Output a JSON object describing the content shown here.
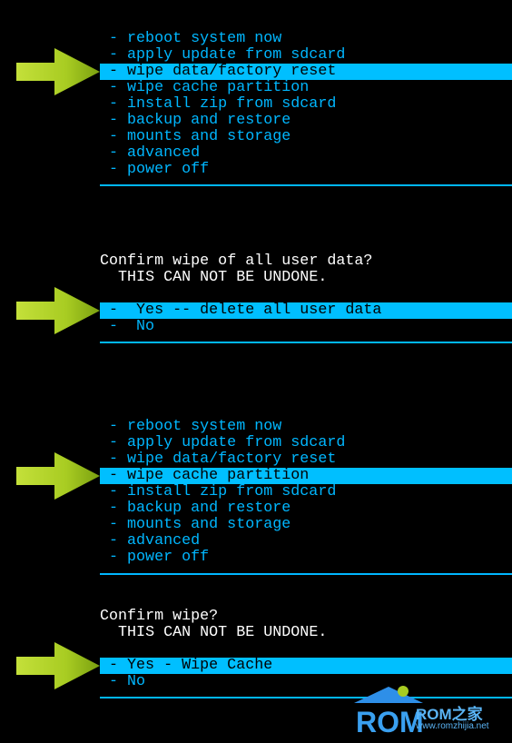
{
  "colors": {
    "menu_text": "#00b7ff",
    "highlight": "#00bfff",
    "arrow": "#a8cc22",
    "background": "#000000"
  },
  "menu1": {
    "items": [
      "- reboot system now",
      "- apply update from sdcard",
      "- wipe data/factory reset",
      "- wipe cache partition",
      "- install zip from sdcard",
      "- backup and restore",
      "- mounts and storage",
      "- advanced",
      "- power off"
    ],
    "selected": 2
  },
  "confirm1": {
    "title": "Confirm wipe of all user data?",
    "warning": "  THIS CAN NOT BE UNDONE.",
    "options": [
      "-  Yes -- delete all user data",
      "-  No"
    ],
    "selected": 0
  },
  "menu2": {
    "items": [
      "- reboot system now",
      "- apply update from sdcard",
      "- wipe data/factory reset",
      "- wipe cache partition",
      "- install zip from sdcard",
      "- backup and restore",
      "- mounts and storage",
      "- advanced",
      "- power off"
    ],
    "selected": 3
  },
  "confirm2": {
    "title": "Confirm wipe?",
    "warning": "  THIS CAN NOT BE UNDONE.",
    "options": [
      "- Yes - Wipe Cache",
      "- No"
    ],
    "selected": 0
  },
  "watermark": {
    "logo": "ROM",
    "brand": "ROM之家",
    "url": "www.romzhijia.net"
  }
}
